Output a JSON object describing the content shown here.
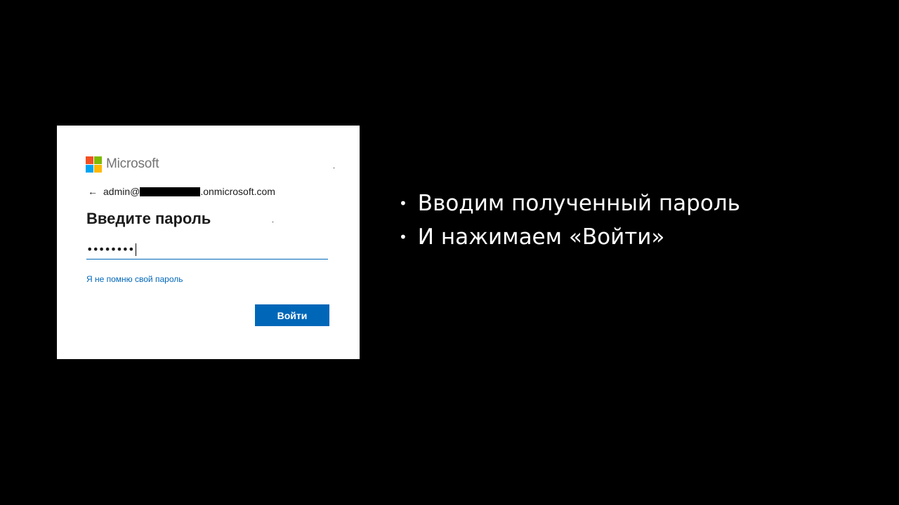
{
  "signin": {
    "brand": "Microsoft",
    "brand_colors": [
      "#f25022",
      "#7fba00",
      "#00a4ef",
      "#ffb900"
    ],
    "back_icon": "left-arrow-icon",
    "back_glyph": "←",
    "email_prefix": "admin@",
    "email_suffix": ".onmicrosoft.com",
    "heading": "Введите пароль",
    "password_value": "••••••••",
    "forgot_link": "Я не помню свой пароль",
    "submit_label": "Войти",
    "accent_color": "#0067b8"
  },
  "instructions": {
    "bullet": "•",
    "items": [
      "Вводим полученный пароль",
      "И нажимаем «Войти»"
    ]
  }
}
